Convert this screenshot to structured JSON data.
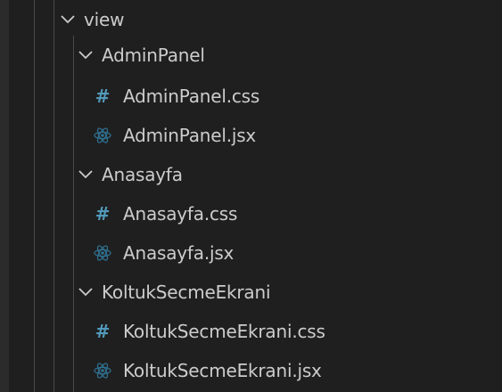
{
  "explorer": {
    "colors": {
      "background": "#1f1f1f",
      "text": "#cccccc",
      "css_icon": "#519aba",
      "react_icon": "#2f6f8f"
    },
    "tree": {
      "view_folder": {
        "label": "view",
        "icon": "chevron-down-icon"
      },
      "adminpanel_folder": {
        "label": "AdminPanel",
        "icon": "chevron-down-icon"
      },
      "adminpanel_css": {
        "label": "AdminPanel.css",
        "icon": "css-hash-icon"
      },
      "adminpanel_jsx": {
        "label": "AdminPanel.jsx",
        "icon": "react-icon"
      },
      "anasayfa_folder": {
        "label": "Anasayfa",
        "icon": "chevron-down-icon"
      },
      "anasayfa_css": {
        "label": "Anasayfa.css",
        "icon": "css-hash-icon"
      },
      "anasayfa_jsx": {
        "label": "Anasayfa.jsx",
        "icon": "react-icon"
      },
      "koltuk_folder": {
        "label": "KoltukSecmeEkrani",
        "icon": "chevron-down-icon"
      },
      "koltuk_css": {
        "label": "KoltukSecmeEkrani.css",
        "icon": "css-hash-icon"
      },
      "koltuk_jsx": {
        "label": "KoltukSecmeEkrani.jsx",
        "icon": "react-icon"
      }
    }
  }
}
